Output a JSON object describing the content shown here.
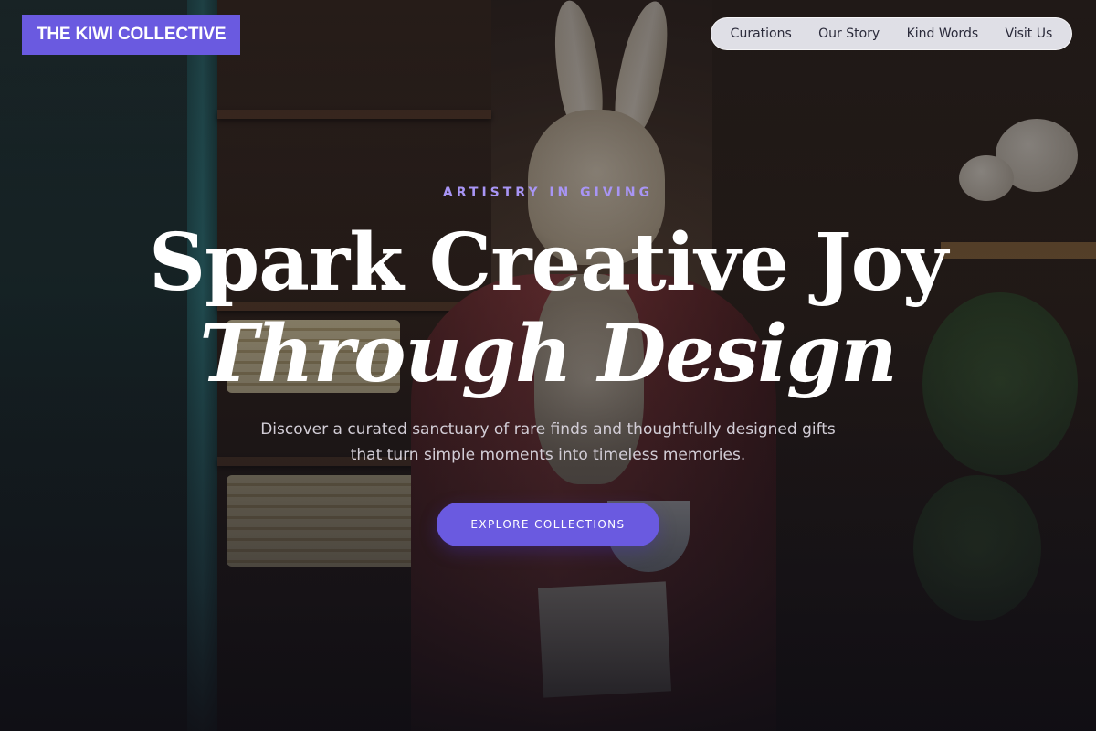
{
  "header": {
    "brand": "THE KIWI COLLECTIVE",
    "nav": [
      "Curations",
      "Our Story",
      "Kind Words",
      "Visit Us"
    ]
  },
  "hero": {
    "eyebrow": "ARTISTRY IN GIVING",
    "headline_line1": "Spark Creative Joy",
    "headline_line2": "Through Design",
    "subtitle": "Discover a curated sanctuary of rare finds and thoughtfully designed gifts that turn simple moments into timeless memories.",
    "cta_label": "EXPLORE COLLECTIONS"
  },
  "colors": {
    "accent": "#6a5ae0",
    "eyebrow": "#a895f5"
  }
}
